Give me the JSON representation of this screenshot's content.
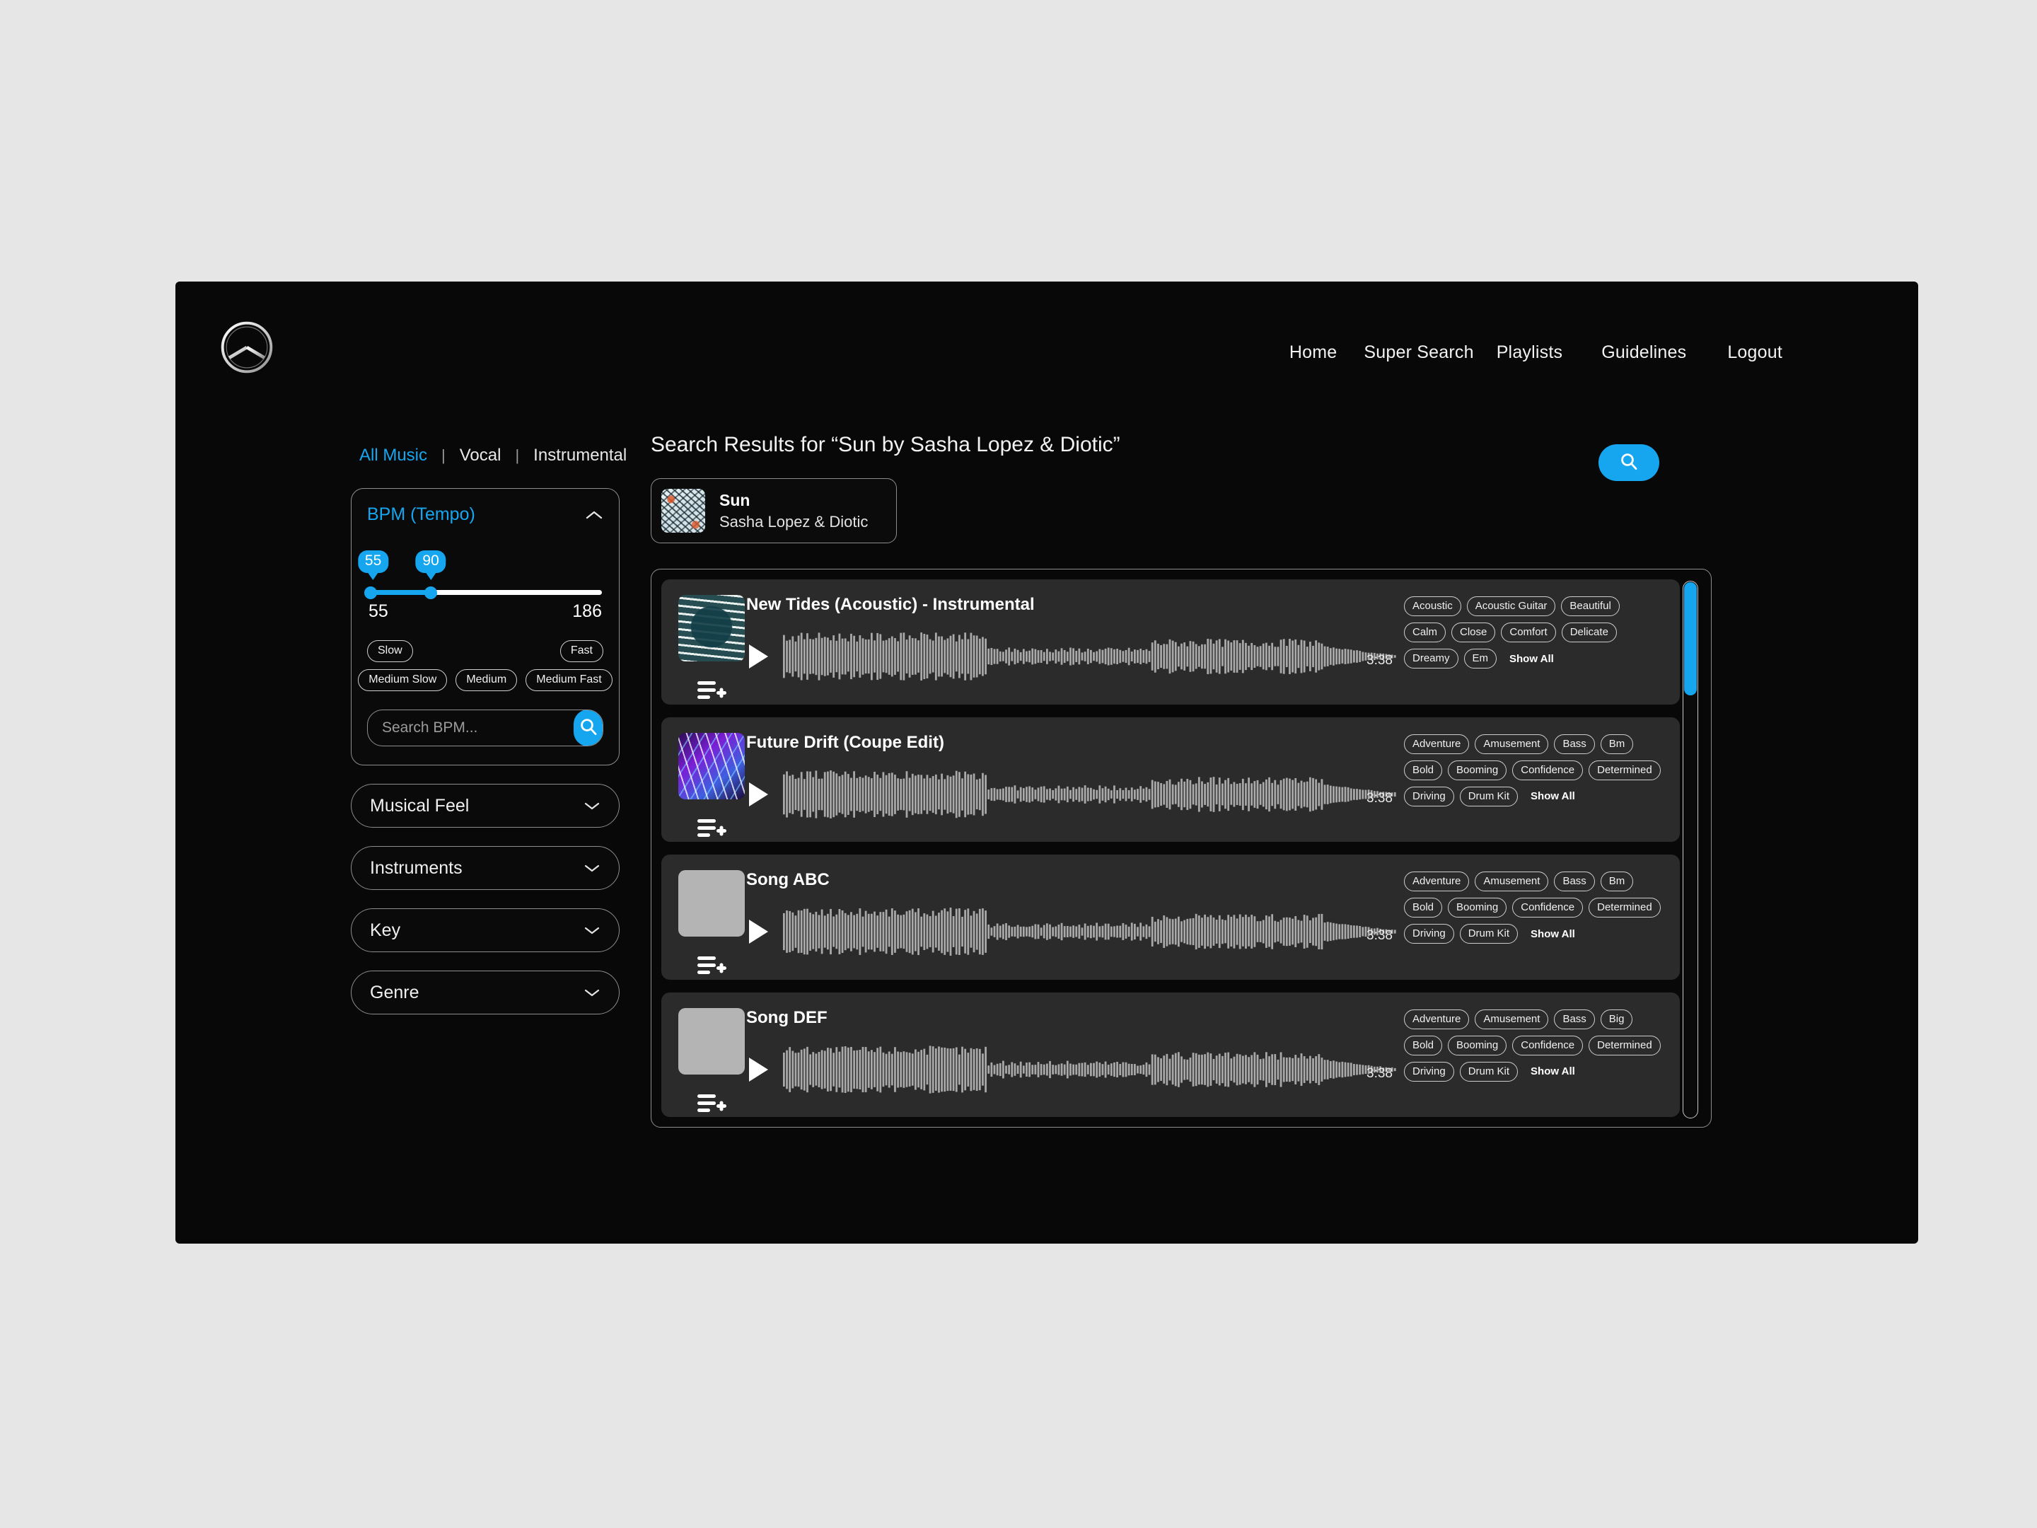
{
  "header": {
    "logo_name": "mercedes-benz-star-logo",
    "nav": [
      {
        "label": "Home"
      },
      {
        "label": "Super Search"
      },
      {
        "label": "Playlists"
      },
      {
        "label": "Guidelines"
      },
      {
        "label": "Logout"
      }
    ]
  },
  "accent_color": "#16a6f0",
  "filters": {
    "music_type_tabs": [
      {
        "label": "All Music",
        "active": true
      },
      {
        "label": "Vocal",
        "active": false
      },
      {
        "label": "Instrumental",
        "active": false
      }
    ],
    "tab_separator": "|",
    "bpm": {
      "title": "BPM (Tempo)",
      "collapse_icon": "chevron-up-icon",
      "handle_low_value": "55",
      "handle_high_value": "90",
      "range_min": "55",
      "range_max": "186",
      "tempo_chips": [
        "Slow",
        "Fast",
        "Medium Slow",
        "Medium",
        "Medium Fast"
      ],
      "search_placeholder": "Search BPM...",
      "search_value": "",
      "search_icon": "search-icon"
    },
    "groups": [
      {
        "label": "Musical Feel",
        "icon": "chevron-down-icon"
      },
      {
        "label": "Instruments",
        "icon": "chevron-down-icon"
      },
      {
        "label": "Key",
        "icon": "chevron-down-icon"
      },
      {
        "label": "Genre",
        "icon": "chevron-down-icon"
      }
    ]
  },
  "results": {
    "title": "Search Results for “Sun by Sasha Lopez & Diotic”",
    "search_button_icon": "search-icon",
    "selected_track": {
      "title": "Sun",
      "artist": "Sasha Lopez & Diotic",
      "art": "floral-sun-artwork"
    },
    "show_all_label": "Show All",
    "rows": [
      {
        "title": "New Tides (Acoustic) - Instrumental",
        "duration": "3:38",
        "art_style": "art-waves",
        "art_name": "ocean-waves-artwork",
        "tags": [
          "Acoustic",
          "Acoustic Guitar",
          "Beautiful",
          "Calm",
          "Close",
          "Comfort",
          "Delicate",
          "Dreamy",
          "Em"
        ]
      },
      {
        "title": "Future Drift (Coupe Edit)",
        "duration": "3:38",
        "art_style": "art-neon",
        "art_name": "neon-lights-artwork",
        "tags": [
          "Adventure",
          "Amusement",
          "Bass",
          "Bm",
          "Bold",
          "Booming",
          "Confidence",
          "Determined",
          "Driving",
          "Drum Kit"
        ]
      },
      {
        "title": "Song ABC",
        "duration": "3:38",
        "art_style": "art-blank",
        "art_name": "placeholder-artwork",
        "tags": [
          "Adventure",
          "Amusement",
          "Bass",
          "Bm",
          "Bold",
          "Booming",
          "Confidence",
          "Determined",
          "Driving",
          "Drum Kit"
        ]
      },
      {
        "title": "Song DEF",
        "duration": "3:38",
        "art_style": "art-blank",
        "art_name": "placeholder-artwork",
        "tags": [
          "Adventure",
          "Amusement",
          "Bass",
          "Big",
          "Bold",
          "Booming",
          "Confidence",
          "Determined",
          "Driving",
          "Drum Kit"
        ]
      }
    ]
  }
}
